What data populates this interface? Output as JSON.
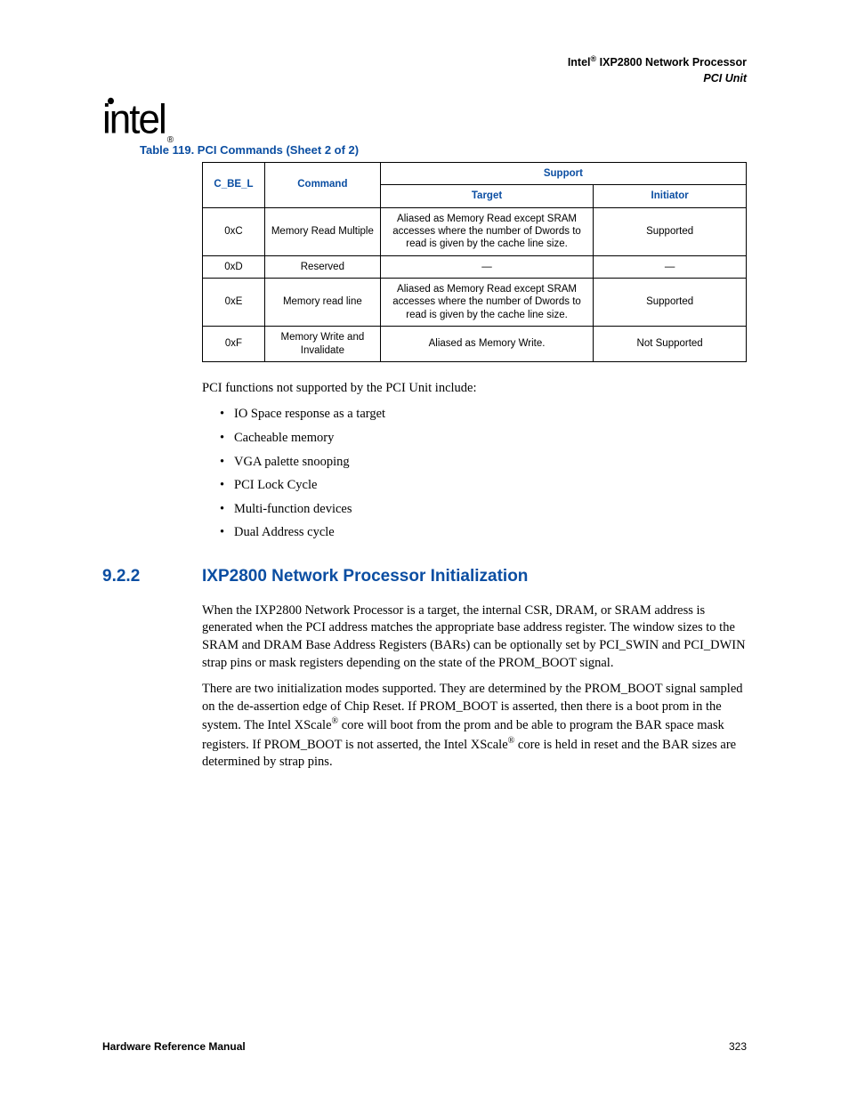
{
  "header": {
    "product_prefix": "Intel",
    "product_name": " IXP2800 Network Processor",
    "subunit": "PCI Unit"
  },
  "table": {
    "caption": "Table 119. PCI Commands  (Sheet 2 of 2)",
    "headers": {
      "cbel": "C_BE_L",
      "command": "Command",
      "support": "Support",
      "target": "Target",
      "initiator": "Initiator"
    },
    "rows": [
      {
        "cbel": "0xC",
        "command": "Memory Read Multiple",
        "target": "Aliased as Memory Read except SRAM accesses where the number of Dwords to read is given by the cache line size.",
        "initiator": "Supported"
      },
      {
        "cbel": "0xD",
        "command": "Reserved",
        "target": "—",
        "initiator": "—"
      },
      {
        "cbel": "0xE",
        "command": "Memory read line",
        "target": "Aliased as Memory Read except SRAM accesses where the number of Dwords to read is given by the cache line size.",
        "initiator": "Supported"
      },
      {
        "cbel": "0xF",
        "command": "Memory Write and Invalidate",
        "target": "Aliased as Memory Write.",
        "initiator": "Not Supported"
      }
    ]
  },
  "intro_line": "PCI functions not supported by the PCI Unit include:",
  "bullets": [
    "IO Space response as a target",
    "Cacheable memory",
    "VGA palette snooping",
    "PCI Lock Cycle",
    "Multi-function devices",
    "Dual Address cycle"
  ],
  "section": {
    "number": "9.2.2",
    "title": "IXP2800 Network Processor Initialization"
  },
  "paragraphs": {
    "p1": "When the IXP2800 Network Processor is a target, the internal CSR, DRAM, or SRAM address is generated when the PCI address matches the appropriate base address register. The window sizes to the SRAM and DRAM Base Address Registers (BARs) can be optionally set by PCI_SWIN and PCI_DWIN strap pins or mask registers depending on the state of the PROM_BOOT signal.",
    "p2a": "There are two initialization modes supported. They are determined by the PROM_BOOT signal sampled on the de-assertion edge of Chip Reset. If PROM_BOOT is asserted, then there is a boot prom in the system. The Intel XScale",
    "p2b": " core will boot from the prom and be able to program the BAR space mask registers. If PROM_BOOT is not asserted, the Intel XScale",
    "p2c": " core is held in reset and the BAR sizes are determined by strap pins."
  },
  "footer": {
    "left": "Hardware Reference Manual",
    "right": "323"
  }
}
